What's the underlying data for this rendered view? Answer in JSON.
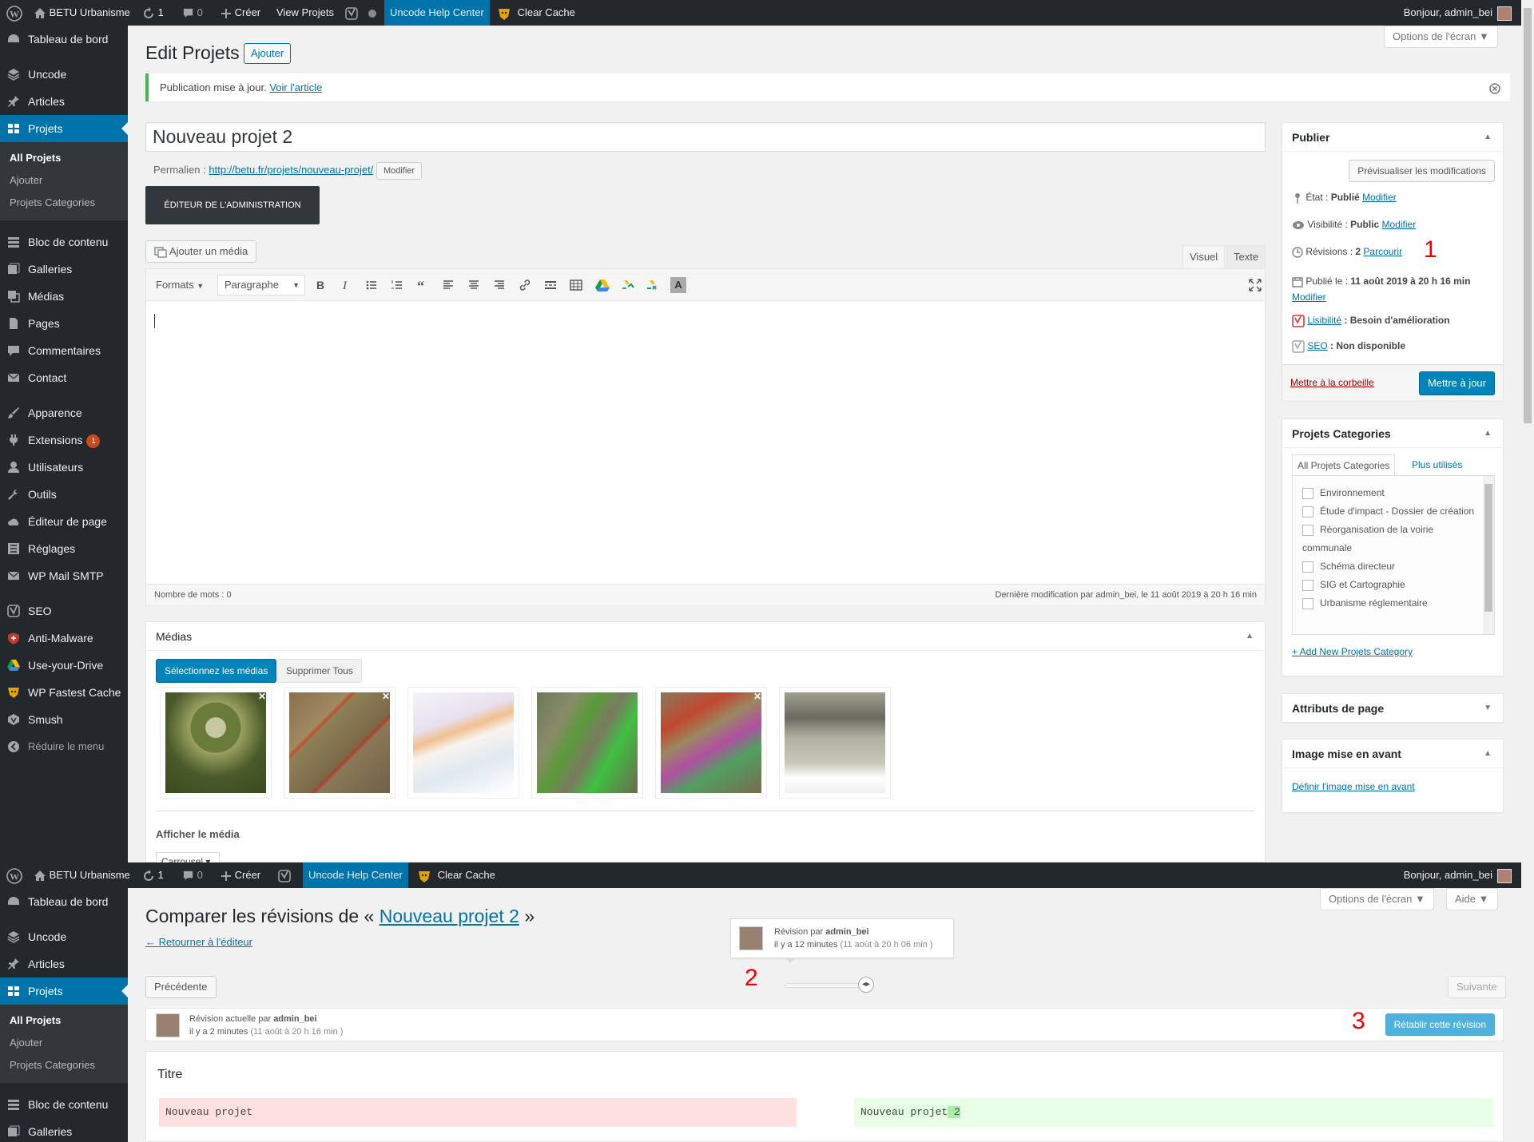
{
  "adminbar": {
    "site": "BETU Urbanisme",
    "updates": "1",
    "comments": "0",
    "new": "Créer",
    "view": "View Projets",
    "help": "Uncode Help Center",
    "cache": "Clear Cache",
    "greeting": "Bonjour, admin_bei"
  },
  "sidebar": {
    "items": [
      {
        "label": "Tableau de bord",
        "icon": "dashboard-icon"
      },
      {
        "label": "Uncode",
        "icon": "layers-icon"
      },
      {
        "label": "Articles",
        "icon": "pin-icon"
      },
      {
        "label": "Projets",
        "icon": "portfolio-icon"
      },
      {
        "label": "Bloc de contenu",
        "icon": "blocks-icon"
      },
      {
        "label": "Galleries",
        "icon": "gallery-icon"
      },
      {
        "label": "Médias",
        "icon": "media-icon"
      },
      {
        "label": "Pages",
        "icon": "page-icon"
      },
      {
        "label": "Commentaires",
        "icon": "comment-icon"
      },
      {
        "label": "Contact",
        "icon": "mail-icon"
      },
      {
        "label": "Apparence",
        "icon": "brush-icon"
      },
      {
        "label": "Extensions",
        "icon": "plugin-icon",
        "badge": "1"
      },
      {
        "label": "Utilisateurs",
        "icon": "user-icon"
      },
      {
        "label": "Outils",
        "icon": "wrench-icon"
      },
      {
        "label": "Éditeur de page",
        "icon": "cloud-icon"
      },
      {
        "label": "Réglages",
        "icon": "settings-icon"
      },
      {
        "label": "WP Mail SMTP",
        "icon": "mail-send-icon"
      },
      {
        "label": "SEO",
        "icon": "yoast-icon"
      },
      {
        "label": "Anti-Malware",
        "icon": "shield-icon"
      },
      {
        "label": "Use-your-Drive",
        "icon": "drive-icon"
      },
      {
        "label": "WP Fastest Cache",
        "icon": "cheetah-icon"
      },
      {
        "label": "Smush",
        "icon": "smush-icon"
      }
    ],
    "submenu": [
      "All Projets",
      "Ajouter",
      "Projets Categories"
    ],
    "collapse": "Réduire le menu"
  },
  "screen_options": "Options de l'écran",
  "help_tab": "Aide",
  "editor": {
    "title": "Edit Projets",
    "add_new": "Ajouter",
    "notice": "Publication mise à jour.",
    "notice_link": "Voir l'article",
    "post_title": "Nouveau projet 2",
    "permalink_label": "Permalien :",
    "permalink_url": "http://betu.fr/projets/nouveau-projet/",
    "permalink_edit": "Modifier",
    "backend_editor": "ÉDITEUR DE L'ADMINISTRATION",
    "add_media": "Ajouter un média",
    "tab_visual": "Visuel",
    "tab_text": "Texte",
    "formats": "Formats",
    "paragraph": "Paragraphe",
    "word_count": "Nombre de mots : 0",
    "last_modified": "Dernière modification par admin_bei, le 11 août 2019 à 20 h 16 min"
  },
  "medias": {
    "title": "Médias",
    "select": "Sélectionnez les médias",
    "delete_all": "Supprimer Tous",
    "display": "Afficher le média",
    "display_value": "Carrousel"
  },
  "publish": {
    "title": "Publier",
    "preview": "Prévisualiser les modifications",
    "status_label": "État :",
    "status_value": "Publié",
    "status_edit": "Modifier",
    "visibility_label": "Visibilité :",
    "visibility_value": "Public",
    "visibility_edit": "Modifier",
    "revisions_label": "Révisions :",
    "revisions_value": "2",
    "revisions_link": "Parcourir",
    "published_label": "Publié le :",
    "published_value": "11 août 2019 à 20 h 16 min",
    "published_edit": "Modifier",
    "readability_link": "Lisibilité",
    "readability_value": ": Besoin d'amélioration",
    "seo_link": "SEO",
    "seo_value": ": Non disponible",
    "trash": "Mettre à la corbeille",
    "update": "Mettre à jour"
  },
  "categories": {
    "title": "Projets Categories",
    "tab_all": "All Projets Categories",
    "tab_popular": "Plus utilisés",
    "items": [
      "Environnement",
      "Étude d'impact - Dossier de création",
      "Réorganisation de la voirie communale",
      "Schéma directeur",
      "SIG et Cartographie",
      "Urbanisme réglementaire"
    ],
    "add_new": "+ Add New Projets Category"
  },
  "page_attributes": {
    "title": "Attributs de page"
  },
  "featured_image": {
    "title": "Image mise en avant",
    "link": "Définir l'image mise en avant"
  },
  "revisions": {
    "title_prefix": "Comparer les révisions de «",
    "title_link": "Nouveau projet 2",
    "title_suffix": "»",
    "back": "← Retourner à l'éditeur",
    "tooltip_by": "Révision par",
    "tooltip_author": "admin_bei",
    "tooltip_ago": "il y a 12 minutes",
    "tooltip_date": "(11 août à 20 h 06 min )",
    "previous": "Précédente",
    "next": "Suivante",
    "current_by": "Révision actuelle par",
    "current_author": "admin_bei",
    "current_ago": "il y a 2 minutes",
    "current_date": "(11 août à 20 h 16 min )",
    "restore": "Rétablir cette révision",
    "field": "Titre",
    "left": "Nouveau projet",
    "right_base": "Nouveau projet",
    "right_added": " 2"
  },
  "markers": {
    "one": "1",
    "two": "2",
    "three": "3"
  },
  "colors": {
    "admin_bar": "#23282d",
    "menu_current": "#0073aa",
    "primary_button": "#0085ba",
    "diff_removed": "#ffe0e0",
    "diff_added": "#e6ffe6",
    "marker": "#e00000"
  }
}
